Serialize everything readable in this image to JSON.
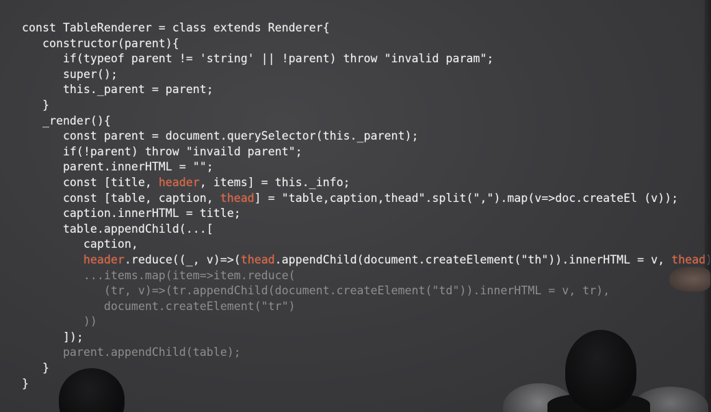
{
  "slide": {
    "code_lines": [
      [
        {
          "text": "const TableRenderer = class extends Renderer{",
          "style": "default"
        }
      ],
      [
        {
          "text": "   constructor(parent){",
          "style": "default"
        }
      ],
      [
        {
          "text": "      if(typeof parent != 'string' || !parent) throw \"invalid param\";",
          "style": "default"
        }
      ],
      [
        {
          "text": "      super();",
          "style": "default"
        }
      ],
      [
        {
          "text": "      this._parent = parent;",
          "style": "default"
        }
      ],
      [
        {
          "text": "   }",
          "style": "default"
        }
      ],
      [
        {
          "text": "   _render(){",
          "style": "default"
        }
      ],
      [
        {
          "text": "      const parent = document.querySelector(this._parent);",
          "style": "default"
        }
      ],
      [
        {
          "text": "      if(!parent) throw \"invaild parent\";",
          "style": "default"
        }
      ],
      [
        {
          "text": "      parent.innerHTML = \"\";",
          "style": "default"
        }
      ],
      [
        {
          "text": "      const [title, ",
          "style": "default"
        },
        {
          "text": "header",
          "style": "orange"
        },
        {
          "text": ", items] = this._info;",
          "style": "default"
        }
      ],
      [
        {
          "text": "      const [table, caption, ",
          "style": "default"
        },
        {
          "text": "thead",
          "style": "orange"
        },
        {
          "text": "] = \"table,caption,thead\".split(\",\").map(v=>doc.createEl (v));",
          "style": "default"
        }
      ],
      [
        {
          "text": "      caption.innerHTML = title;",
          "style": "default"
        }
      ],
      [
        {
          "text": "      table.appendChild(...[",
          "style": "default"
        }
      ],
      [
        {
          "text": "         caption,",
          "style": "default"
        }
      ],
      [
        {
          "text": "         ",
          "style": "default"
        },
        {
          "text": "header",
          "style": "orange"
        },
        {
          "text": ".reduce((_, v)=>(",
          "style": "default"
        },
        {
          "text": "thead",
          "style": "orange"
        },
        {
          "text": ".appendChild(document.createElement(\"th\")).innerHTML = v, ",
          "style": "default"
        },
        {
          "text": "thead",
          "style": "orange"
        },
        {
          "text": ")),",
          "style": "default"
        }
      ],
      [
        {
          "text": "         ...items.map(item=>item.reduce(",
          "style": "dim"
        }
      ],
      [
        {
          "text": "            (tr, v)=>(tr.appendChild(document.createElement(\"td\")).innerHTML = v, tr),",
          "style": "dim"
        }
      ],
      [
        {
          "text": "            document.createElement(\"tr\")",
          "style": "dim"
        }
      ],
      [
        {
          "text": "         ))",
          "style": "dim"
        }
      ],
      [
        {
          "text": "      ]);",
          "style": "default"
        }
      ],
      [
        {
          "text": "      parent.appendChild(table);",
          "style": "dim"
        }
      ],
      [
        {
          "text": "   }",
          "style": "default"
        }
      ],
      [
        {
          "text": "}",
          "style": "default"
        }
      ]
    ]
  },
  "colors": {
    "code_default": "#f2f2f2",
    "code_highlight": "#e8623a",
    "code_dim": "#8e8e90",
    "screen_background": "#3b3b3e"
  },
  "scene": {
    "audience_heads": [
      "dark-hair-head-left",
      "dark-hair-head-right",
      "gray-hair-head-center",
      "gray-hair-head-right"
    ],
    "presenter_hand": "pointing-hand"
  }
}
